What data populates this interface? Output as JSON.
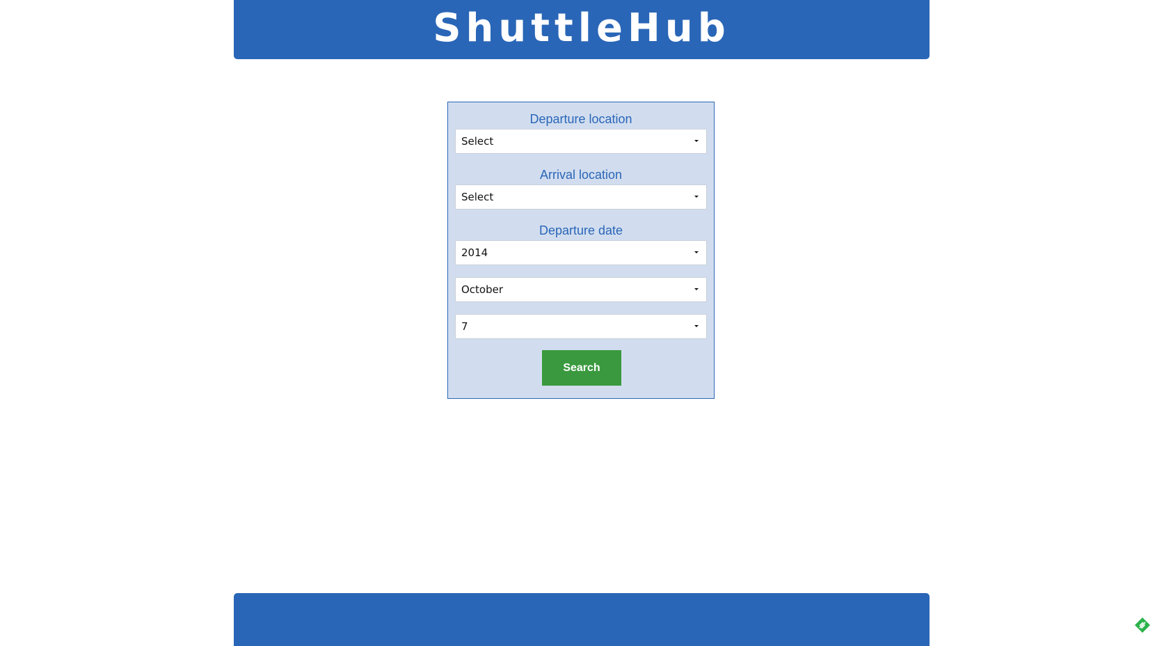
{
  "header": {
    "logo_text": "ShuttleHub"
  },
  "form": {
    "departure_location": {
      "label": "Departure location",
      "value": "Select"
    },
    "arrival_location": {
      "label": "Arrival location",
      "value": "Select"
    },
    "departure_date": {
      "label": "Departure date",
      "year": "2014",
      "month": "October",
      "day": "7"
    },
    "search_label": "Search"
  },
  "icons": {
    "select_caret": "chevron-down-icon",
    "corner_badge": "feedly-icon"
  },
  "colors": {
    "brand_blue": "#2a66b7",
    "panel_background": "#d1ddef",
    "search_green": "#3a993e",
    "badge_green": "#2bb24c"
  }
}
